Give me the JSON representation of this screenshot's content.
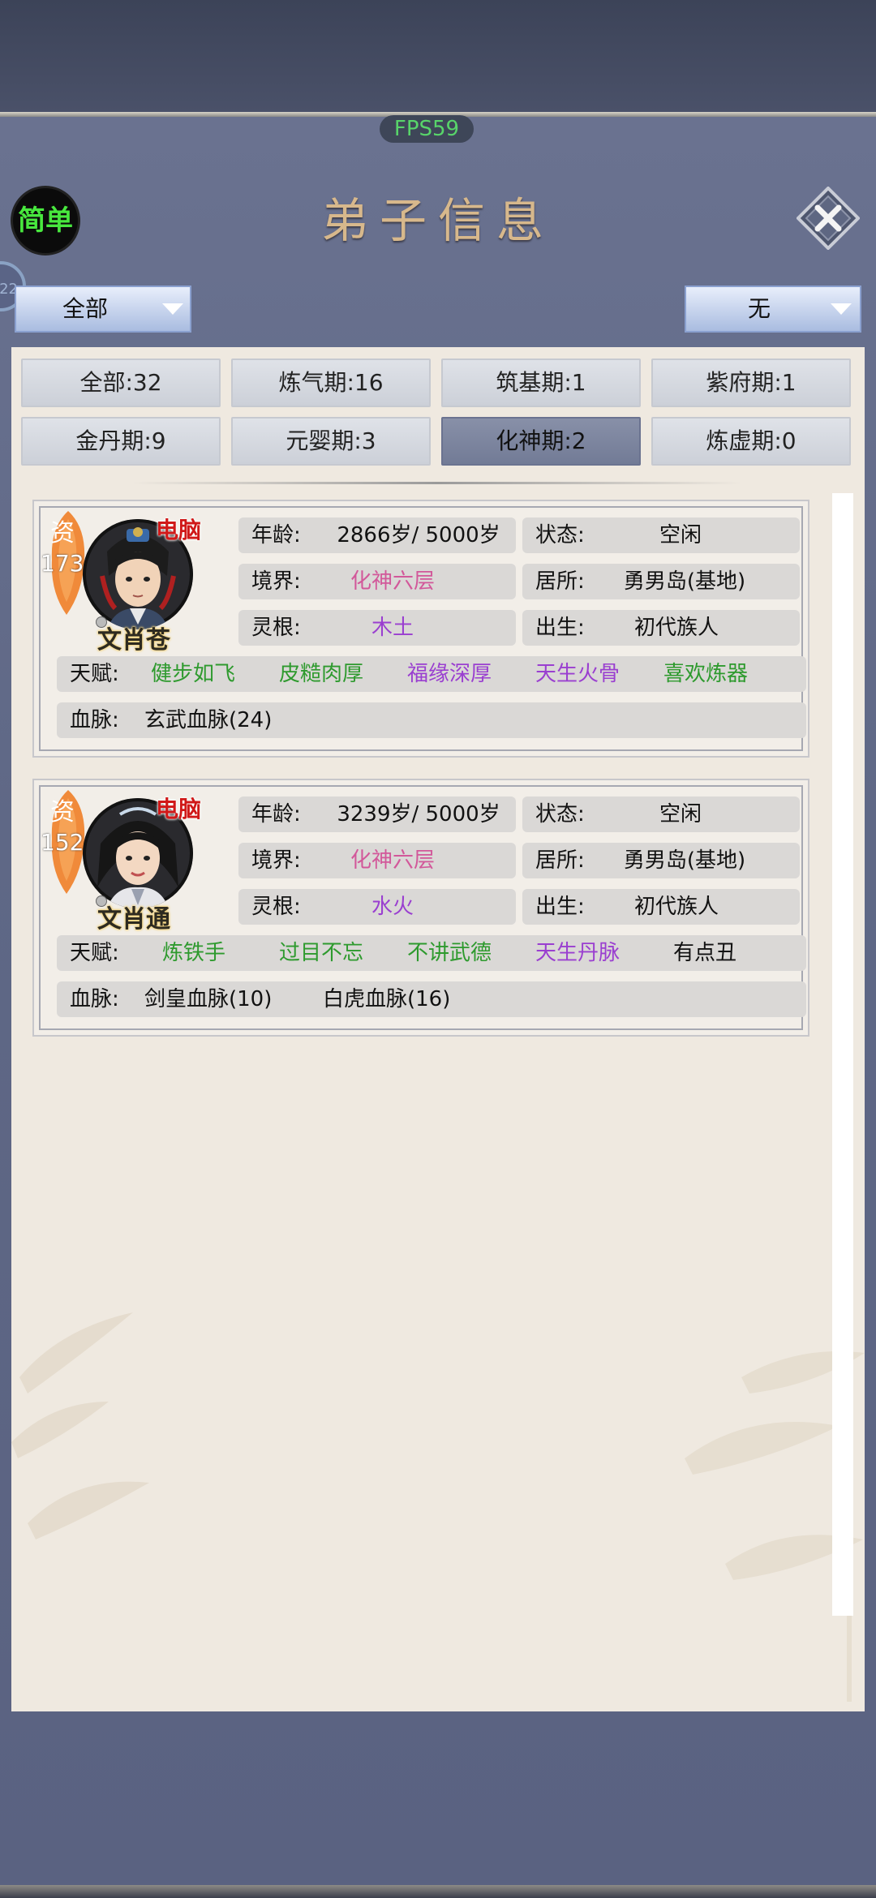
{
  "fps": "FPS59",
  "header": {
    "title": "弟子信息",
    "mode_button": "简单",
    "side_orb": "22"
  },
  "filters": {
    "left_dropdown": "全部",
    "right_dropdown": "无"
  },
  "realm_tabs": [
    {
      "label": "全部:32"
    },
    {
      "label": "炼气期:16"
    },
    {
      "label": "筑基期:1"
    },
    {
      "label": "紫府期:1"
    },
    {
      "label": "金丹期:9"
    },
    {
      "label": "元婴期:3"
    },
    {
      "label": "化神期:2",
      "active": true
    },
    {
      "label": "炼虚期:0"
    }
  ],
  "labels": {
    "aptitude": "资",
    "ai": "电脑",
    "age": "年龄:",
    "status": "状态:",
    "realm": "境界:",
    "residence": "居所:",
    "root": "灵根:",
    "origin": "出生:",
    "talent": "天赋:",
    "bloodline": "血脉:"
  },
  "disciples": [
    {
      "name": "文肖苍",
      "aptitude": "173",
      "age": "2866岁/ 5000岁",
      "status": "空闲",
      "realm": "化神六层",
      "residence": "勇男岛(基地)",
      "root": "木土",
      "origin": "初代族人",
      "talents": [
        "健步如飞",
        "皮糙肉厚",
        "福缘深厚",
        "天生火骨",
        "喜欢炼器"
      ],
      "bloodlines": [
        "玄武血脉(24)"
      ]
    },
    {
      "name": "文肖通",
      "aptitude": "152",
      "age": "3239岁/ 5000岁",
      "status": "空闲",
      "realm": "化神六层",
      "residence": "勇男岛(基地)",
      "root": "水火",
      "origin": "初代族人",
      "talents": [
        "炼铁手",
        "过目不忘",
        "不讲武德",
        "天生丹脉",
        "有点丑"
      ],
      "bloodlines": [
        "剑皇血脉(10)",
        "白虎血脉(16)"
      ]
    }
  ],
  "colors": {
    "accent_green": "#48e83e",
    "realm_pink": "#d2589a",
    "trait_green": "#2e9a2e",
    "trait_purple": "#9a3fd0",
    "ai_red": "#d01818"
  },
  "icons": {
    "close": "close-x-icon",
    "dropdown": "triangle-down-icon"
  }
}
